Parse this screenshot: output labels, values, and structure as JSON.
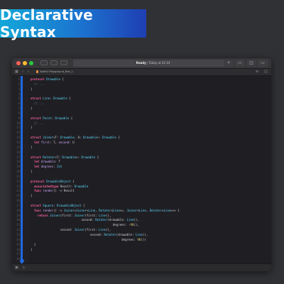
{
  "banner": {
    "title": "Declarative Syntax"
  },
  "window": {
    "status": {
      "state": "Ready",
      "sep": " | ",
      "time": "Today at 21:14"
    },
    "breadcrumb": "SwiftUI  Playground_Part_1",
    "icons": {
      "add": "+",
      "nav_left": "‹",
      "nav_right": "›",
      "grid": "▦",
      "panel_left": "▭",
      "panel_right": "▭",
      "lines": "≡",
      "split": "◫",
      "console": "▣",
      "run": "▷"
    }
  },
  "code": {
    "line_numbers": [
      "1",
      "2",
      "3",
      "4",
      "5",
      "6",
      "7",
      "8",
      "9",
      "10",
      "11",
      "12",
      "13",
      "14",
      "15",
      "16",
      "17",
      "18",
      "19",
      "20",
      "21",
      "22",
      "23",
      "24",
      "25",
      "26",
      "27",
      "28",
      "29",
      "30",
      "31",
      "32",
      "33",
      "34",
      "35",
      "36",
      "37",
      "38"
    ],
    "lines": [
      [
        {
          "t": "protocol",
          "c": "kw"
        },
        {
          "t": " "
        },
        {
          "t": "Drawable",
          "c": "ty"
        },
        {
          "t": " {"
        }
      ],
      [
        {
          "t": "  // ...",
          "c": "cm"
        }
      ],
      [
        {
          "t": "}"
        }
      ],
      [
        {
          "t": ""
        }
      ],
      [
        {
          "t": "struct",
          "c": "kw"
        },
        {
          "t": " "
        },
        {
          "t": "Line",
          "c": "ty"
        },
        {
          "t": ": "
        },
        {
          "t": "Drawable",
          "c": "ty"
        },
        {
          "t": " {"
        }
      ],
      [
        {
          "t": "  // ...",
          "c": "cm"
        }
      ],
      [
        {
          "t": "}"
        }
      ],
      [
        {
          "t": ""
        }
      ],
      [
        {
          "t": "struct",
          "c": "kw"
        },
        {
          "t": " "
        },
        {
          "t": "Point",
          "c": "ty"
        },
        {
          "t": ": "
        },
        {
          "t": "Drawable",
          "c": "ty"
        },
        {
          "t": " {"
        }
      ],
      [
        {
          "t": "  // ...",
          "c": "cm"
        }
      ],
      [
        {
          "t": "}"
        }
      ],
      [
        {
          "t": ""
        }
      ],
      [
        {
          "t": "struct",
          "c": "kw"
        },
        {
          "t": " "
        },
        {
          "t": "Joiner",
          "c": "ty"
        },
        {
          "t": "<T: "
        },
        {
          "t": "Drawable",
          "c": "ty"
        },
        {
          "t": ", U: "
        },
        {
          "t": "Drawable",
          "c": "ty"
        },
        {
          "t": ">: "
        },
        {
          "t": "Drawable",
          "c": "ty"
        },
        {
          "t": " {"
        }
      ],
      [
        {
          "t": "  "
        },
        {
          "t": "let",
          "c": "kw"
        },
        {
          "t": " "
        },
        {
          "t": "first",
          "c": "id"
        },
        {
          "t": ": T, "
        },
        {
          "t": "second",
          "c": "id"
        },
        {
          "t": ": U"
        }
      ],
      [
        {
          "t": "}"
        }
      ],
      [
        {
          "t": ""
        }
      ],
      [
        {
          "t": "struct",
          "c": "kw"
        },
        {
          "t": " "
        },
        {
          "t": "Rotater",
          "c": "ty"
        },
        {
          "t": "<T: "
        },
        {
          "t": "Drawable",
          "c": "ty"
        },
        {
          "t": ">: "
        },
        {
          "t": "Drawable",
          "c": "ty"
        },
        {
          "t": " {"
        }
      ],
      [
        {
          "t": "  "
        },
        {
          "t": "let",
          "c": "kw"
        },
        {
          "t": " "
        },
        {
          "t": "drawable",
          "c": "id"
        },
        {
          "t": ": T"
        }
      ],
      [
        {
          "t": "  "
        },
        {
          "t": "let",
          "c": "kw"
        },
        {
          "t": " "
        },
        {
          "t": "degrees",
          "c": "id"
        },
        {
          "t": ": "
        },
        {
          "t": "Int",
          "c": "ty"
        }
      ],
      [
        {
          "t": "}"
        }
      ],
      [
        {
          "t": ""
        }
      ],
      [
        {
          "t": "protocol",
          "c": "kw"
        },
        {
          "t": " "
        },
        {
          "t": "DrawableObject",
          "c": "ty"
        },
        {
          "t": " {"
        }
      ],
      [
        {
          "t": "  "
        },
        {
          "t": "associatedtype",
          "c": "kw"
        },
        {
          "t": " Result: "
        },
        {
          "t": "Drawable",
          "c": "ty"
        }
      ],
      [
        {
          "t": "  "
        },
        {
          "t": "func",
          "c": "kw"
        },
        {
          "t": " "
        },
        {
          "t": "render",
          "c": "id"
        },
        {
          "t": "() -> Result"
        }
      ],
      [
        {
          "t": "}"
        }
      ],
      [
        {
          "t": ""
        }
      ],
      [
        {
          "t": "struct",
          "c": "kw"
        },
        {
          "t": " "
        },
        {
          "t": "Square",
          "c": "ty"
        },
        {
          "t": ": "
        },
        {
          "t": "DrawableObject",
          "c": "ty"
        },
        {
          "t": " {"
        }
      ],
      [
        {
          "t": "  "
        },
        {
          "t": "func",
          "c": "kw"
        },
        {
          "t": " "
        },
        {
          "t": "render",
          "c": "id"
        },
        {
          "t": "() -> "
        },
        {
          "t": "Joiner",
          "c": "ty"
        },
        {
          "t": "<"
        },
        {
          "t": "Joiner",
          "c": "ty"
        },
        {
          "t": "<"
        },
        {
          "t": "Line",
          "c": "ty"
        },
        {
          "t": ", "
        },
        {
          "t": "Rotater",
          "c": "ty"
        },
        {
          "t": "<"
        },
        {
          "t": "Line",
          "c": "ty"
        },
        {
          "t": ">>, "
        },
        {
          "t": "Joiner",
          "c": "ty"
        },
        {
          "t": "<"
        },
        {
          "t": "Line",
          "c": "ty"
        },
        {
          "t": ", "
        },
        {
          "t": "Rotater",
          "c": "ty"
        },
        {
          "t": "<"
        },
        {
          "t": "Line",
          "c": "ty"
        },
        {
          "t": ">>> {"
        }
      ],
      [
        {
          "t": "    "
        },
        {
          "t": "return",
          "c": "kw"
        },
        {
          "t": " "
        },
        {
          "t": "Joiner",
          "c": "ty"
        },
        {
          "t": "(first: "
        },
        {
          "t": "Joiner",
          "c": "ty"
        },
        {
          "t": "(first: "
        },
        {
          "t": "Line",
          "c": "ty"
        },
        {
          "t": "(),"
        }
      ],
      [
        {
          "t": "                             second: "
        },
        {
          "t": "Rotater",
          "c": "ty"
        },
        {
          "t": "(drawable: "
        },
        {
          "t": "Line",
          "c": "ty"
        },
        {
          "t": "(),"
        }
      ],
      [
        {
          "t": "                                               degrees: "
        },
        {
          "t": "-90",
          "c": "nm"
        },
        {
          "t": ")),"
        }
      ],
      [
        {
          "t": "                 second: "
        },
        {
          "t": "Joiner",
          "c": "ty"
        },
        {
          "t": "(first: "
        },
        {
          "t": "Line",
          "c": "ty"
        },
        {
          "t": "(),"
        }
      ],
      [
        {
          "t": "                                  second: "
        },
        {
          "t": "Rotater",
          "c": "ty"
        },
        {
          "t": "(drawable: "
        },
        {
          "t": "Line",
          "c": "ty"
        },
        {
          "t": "(),"
        }
      ],
      [
        {
          "t": "                                                    degrees: "
        },
        {
          "t": "90",
          "c": "nm"
        },
        {
          "t": ")))"
        }
      ],
      [
        {
          "t": "  }"
        }
      ],
      [
        {
          "t": "}"
        }
      ],
      [
        {
          "t": ""
        }
      ],
      [
        {
          "t": ""
        }
      ]
    ]
  }
}
